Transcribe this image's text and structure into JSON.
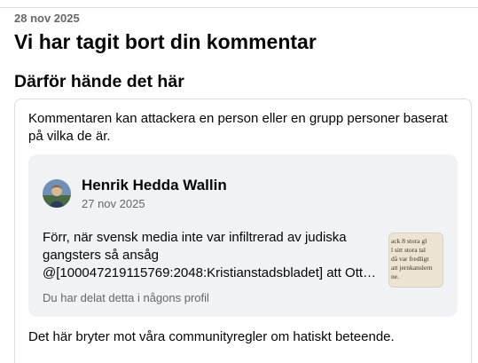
{
  "header": {
    "date": "28 nov 2025",
    "title": "Vi har tagit bort din kommentar"
  },
  "reason_section": {
    "heading": "Därför hände det här",
    "explanation": "Kommentaren kan attackera en person eller en grupp personer baserat på vilka de är.",
    "violation_text": "Det här bryter mot våra communityregler om hatiskt beteende."
  },
  "comment": {
    "author": "Henrik Hedda Wallin",
    "date": "27 nov 2025",
    "text_lines": [
      "Förr, när svensk media inte var infiltrerad av judiska",
      "gangsters så ansåg",
      "@[100047219115769:2048:Kristianstadsbladet] att Ott…"
    ],
    "shared_note": "Du har delat detta i någons profil",
    "thumbnail_text": [
      "ack 8 stora gl",
      "l sitt stora tal",
      "då var fredligt",
      "att jernkanslern",
      "ne."
    ]
  },
  "colors": {
    "text_primary": "#050505",
    "text_secondary": "#65676b",
    "comment_background": "#f0f2f5",
    "border": "#dadde1"
  }
}
